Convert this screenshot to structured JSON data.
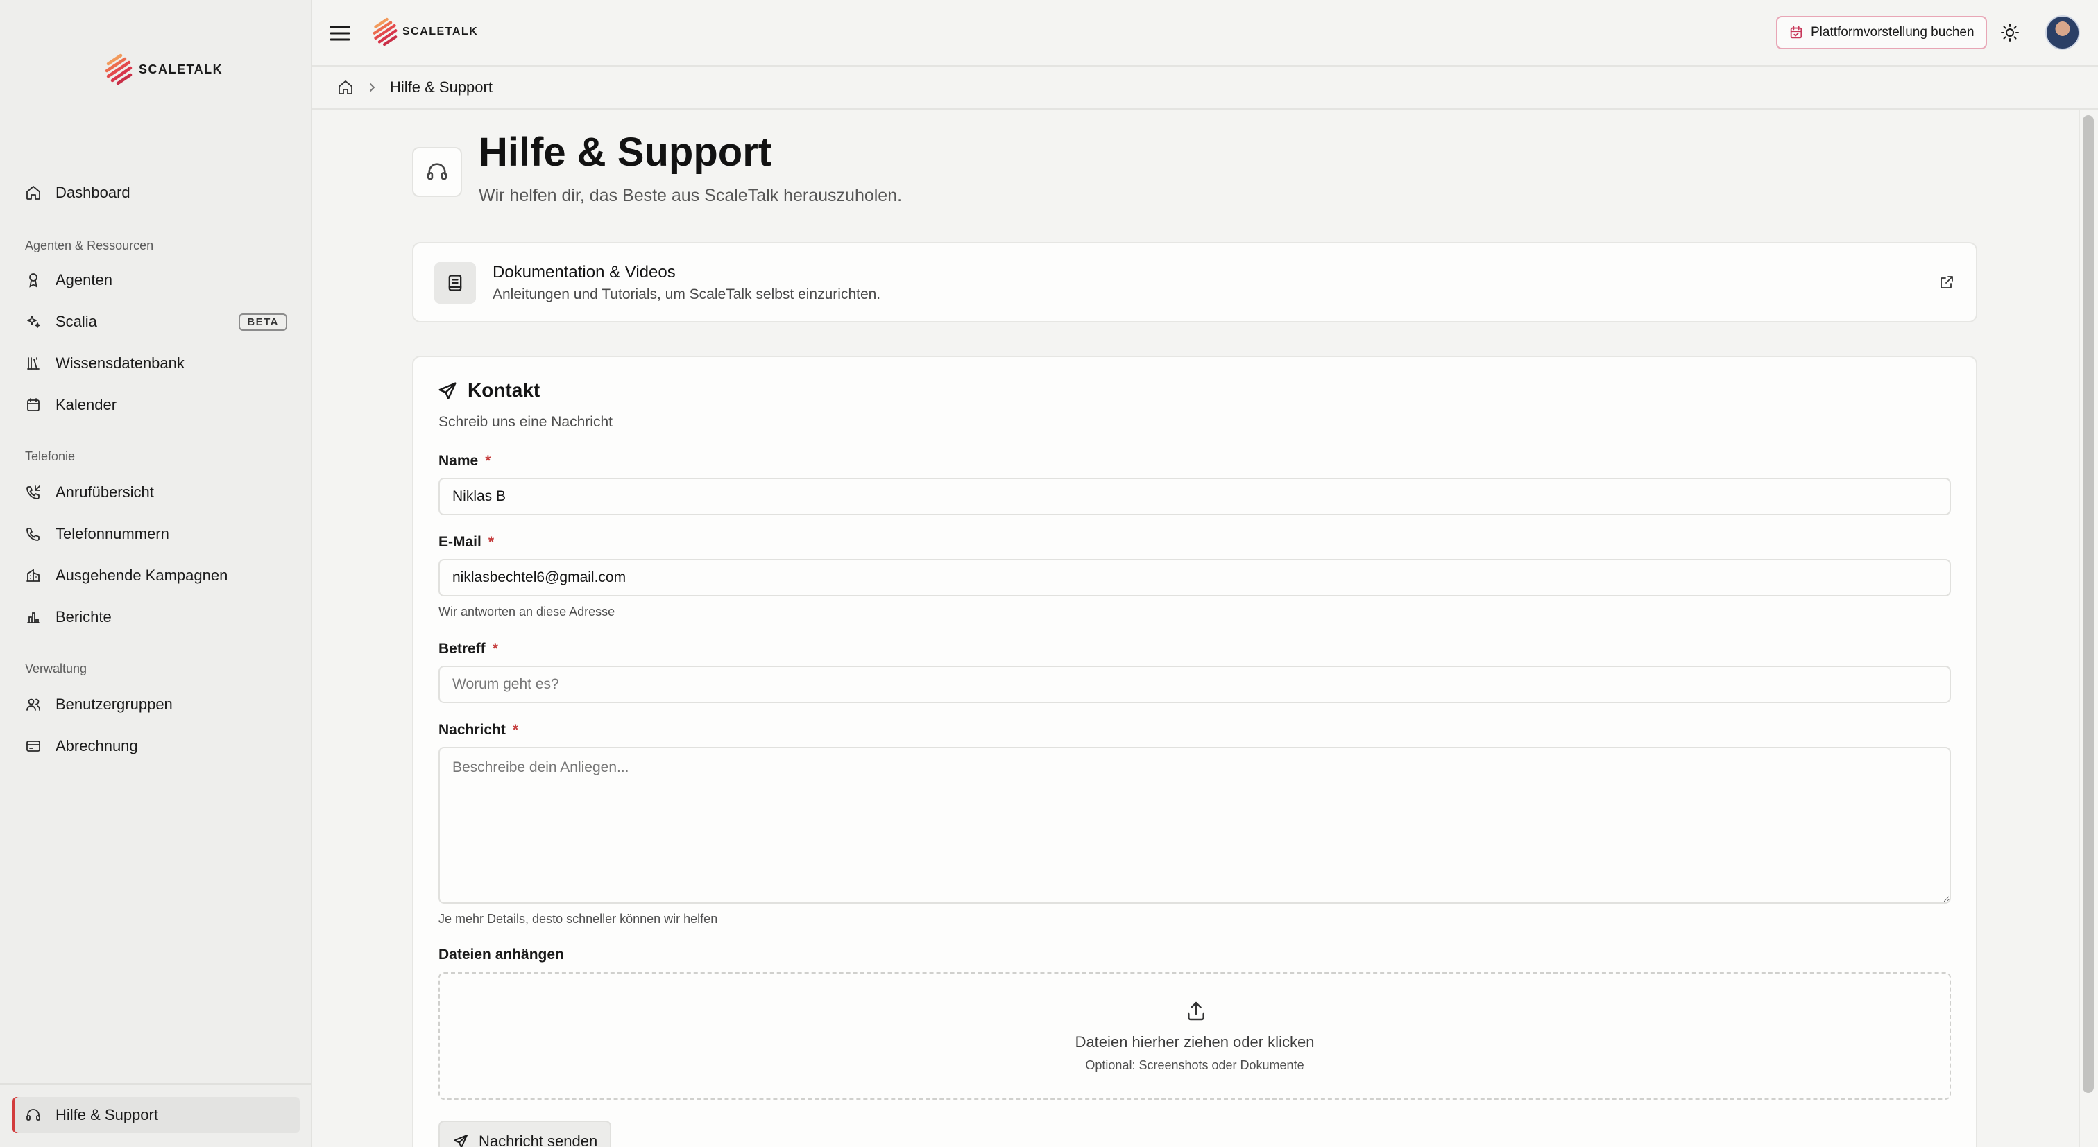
{
  "brand": {
    "name": "SCALETALK",
    "accent": "#e0484c"
  },
  "sidebar": {
    "items_main": [
      {
        "label": "Dashboard",
        "icon": "home-icon"
      }
    ],
    "group_agents": "Agenten & Ressourcen",
    "items_agents": [
      {
        "label": "Agenten",
        "icon": "bot-icon"
      },
      {
        "label": "Scalia",
        "icon": "sparkles-icon",
        "badge": "BETA"
      },
      {
        "label": "Wissensdatenbank",
        "icon": "library-icon"
      },
      {
        "label": "Kalender",
        "icon": "calendar-icon"
      }
    ],
    "group_phone": "Telefonie",
    "items_phone": [
      {
        "label": "Anrufübersicht",
        "icon": "phone-incoming-icon"
      },
      {
        "label": "Telefonnummern",
        "icon": "phone-icon"
      },
      {
        "label": "Ausgehende Kampagnen",
        "icon": "building-icon"
      },
      {
        "label": "Berichte",
        "icon": "bar-chart-icon"
      }
    ],
    "group_admin": "Verwaltung",
    "items_admin": [
      {
        "label": "Benutzergruppen",
        "icon": "users-icon"
      },
      {
        "label": "Abrechnung",
        "icon": "credit-card-icon"
      }
    ],
    "footer_item": {
      "label": "Hilfe & Support",
      "icon": "headset-icon"
    }
  },
  "topbar": {
    "demo_button": "Plattformvorstellung buchen",
    "demo_border_color": "#e8a6b6"
  },
  "breadcrumb": {
    "current": "Hilfe & Support"
  },
  "page": {
    "title": "Hilfe & Support",
    "subtitle": "Wir helfen dir, das Beste aus ScaleTalk herauszuholen."
  },
  "docs_card": {
    "title": "Dokumentation & Videos",
    "subtitle": "Anleitungen und Tutorials, um ScaleTalk selbst einzurichten."
  },
  "contact": {
    "title": "Kontakt",
    "subtitle": "Schreib uns eine Nachricht",
    "required_mark": "*",
    "name": {
      "label": "Name",
      "value": "Niklas B"
    },
    "email": {
      "label": "E-Mail",
      "value": "niklasbechtel6@gmail.com",
      "help": "Wir antworten an diese Adresse"
    },
    "subject": {
      "label": "Betreff",
      "placeholder": "Worum geht es?"
    },
    "message": {
      "label": "Nachricht",
      "placeholder": "Beschreibe dein Anliegen...",
      "help": "Je mehr Details, desto schneller können wir helfen"
    },
    "attachments": {
      "label": "Dateien anhängen",
      "dropzone_text": "Dateien hierher ziehen oder klicken",
      "dropzone_hint": "Optional: Screenshots oder Dokumente"
    },
    "submit": "Nachricht senden"
  }
}
